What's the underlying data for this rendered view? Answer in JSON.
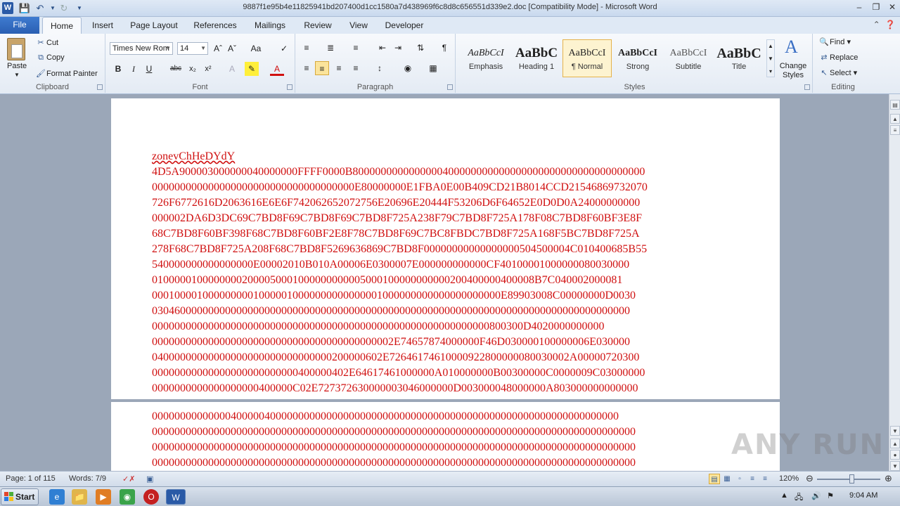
{
  "window": {
    "title": "9887f1e95b4e11825941bd207400d1cc1580a7d438969f6c8d8c656551d339e2.doc [Compatibility Mode] - Microsoft Word",
    "app_icon_letter": "W"
  },
  "ribbon_tabs": [
    "File",
    "Home",
    "Insert",
    "Page Layout",
    "References",
    "Mailings",
    "Review",
    "View",
    "Developer"
  ],
  "clipboard": {
    "paste": "Paste",
    "cut": "Cut",
    "copy": "Copy",
    "format_painter": "Format Painter",
    "group_label": "Clipboard"
  },
  "font": {
    "name": "Times New Rom",
    "size": "14",
    "group_label": "Font"
  },
  "paragraph": {
    "group_label": "Paragraph"
  },
  "styles": {
    "items": [
      {
        "sample": "AaBbCcI",
        "name": "Emphasis"
      },
      {
        "sample": "AaBbC",
        "name": "Heading 1"
      },
      {
        "sample": "AaBbCcI",
        "name": "¶ Normal"
      },
      {
        "sample": "AaBbCcI",
        "name": "Strong"
      },
      {
        "sample": "AaBbCcI",
        "name": "Subtitle"
      },
      {
        "sample": "AaBbC",
        "name": "Title"
      }
    ],
    "change_styles_1": "Change",
    "change_styles_2": "Styles",
    "group_label": "Styles"
  },
  "editing": {
    "find": "Find",
    "replace": "Replace",
    "select": "Select",
    "group_label": "Editing"
  },
  "document": {
    "text_color": "#d01010",
    "page1_lines": [
      "zonevChHeDYdY",
      "4D5A900003000000040000000FFFF0000B8000000000000000400000000000000000000000000000000000",
      "000000000000000000000000000000000000E80000000E1FBA0E00B409CD21B8014CCD21546869732070",
      "726F6772616D2063616E6E6F742062652072756E20696E20444F53206D6F64652E0D0D0A24000000000",
      "000002DA6D3DC69C7BD8F69C7BD8F69C7BD8F725A238F79C7BD8F725A178F08C7BD8F60BF3E8F",
      "68C7BD8F60BF398F68C7BD8F60BF2E8F78C7BD8F69C7BC8FBDC7BD8F725A168F5BC7BD8F725A",
      "278F68C7BD8F725A208F68C7BD8F5269636869C7BD8F00000000000000000504500004C010400685B55",
      "540000000000000000E00002010B010A00006E0300007E000000000000CF40100001000000080030000",
      "01000001000000002000050001000000000005000100000000000200400000400008B7C040002000081",
      "00010000100000000010000010000000000000001000000000000000000000E89903008C00000000D0030",
      "0304600000000000000000000000000000000000000000000000000000000000000000000000000000000",
      "000000000000000000000000000000000000000000000000000000000000800300D4020000000000",
      "0000000000000000000000000000000000000000002E74657874000000F46D030000100000006E030000",
      "04000000000000000000000000000000200000602E72646174610000922800000080030002A00000720300",
      "00000000000000000000000000400000402E64617461000000A010000000B00300000C0000009C03000000",
      "0000000000000000000400000C02E727372630000003046000000D003000048000000A803000000000000"
    ],
    "page2_lines": [
      "00000000000000400000400000000000000000000000000000000000000000000000000000000000000",
      "00000000000000000000000000000000000000000000000000000000000000000000000000000000000000",
      "00000000000000000000000000000000000000000000000000000000000000000000000000000000000000",
      "00000000000000000000000000000000000000000000000000000000000000000000000000000000000000"
    ]
  },
  "status": {
    "page": "Page: 1 of 115",
    "words": "Words: 7/9",
    "zoom": "120%"
  },
  "watermark": "ANY RUN",
  "taskbar": {
    "start": "Start",
    "time": "9:04 AM"
  }
}
